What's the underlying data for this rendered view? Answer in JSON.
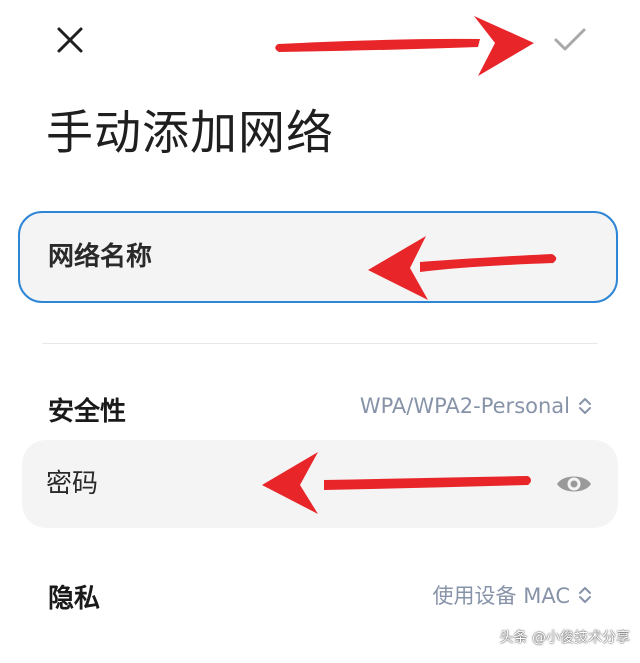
{
  "header": {
    "close_icon": "close-icon",
    "confirm_icon": "checkmark-icon"
  },
  "title": "手动添加网络",
  "network_name": {
    "placeholder": "网络名称",
    "value": ""
  },
  "security": {
    "label": "安全性",
    "value": "WPA/WPA2-Personal",
    "icon": "chevron-up-down-icon"
  },
  "password": {
    "placeholder": "密码",
    "value": "",
    "icon": "eye-icon"
  },
  "privacy": {
    "label": "隐私",
    "value": "使用设备 MAC",
    "icon": "chevron-up-down-icon"
  },
  "watermark": "头条 @小俊技术分享",
  "colors": {
    "accent_border": "#2f86d6",
    "field_bg": "#f4f4f4",
    "value_text": "#8793a8",
    "annotation_arrow": "#e8262a"
  }
}
